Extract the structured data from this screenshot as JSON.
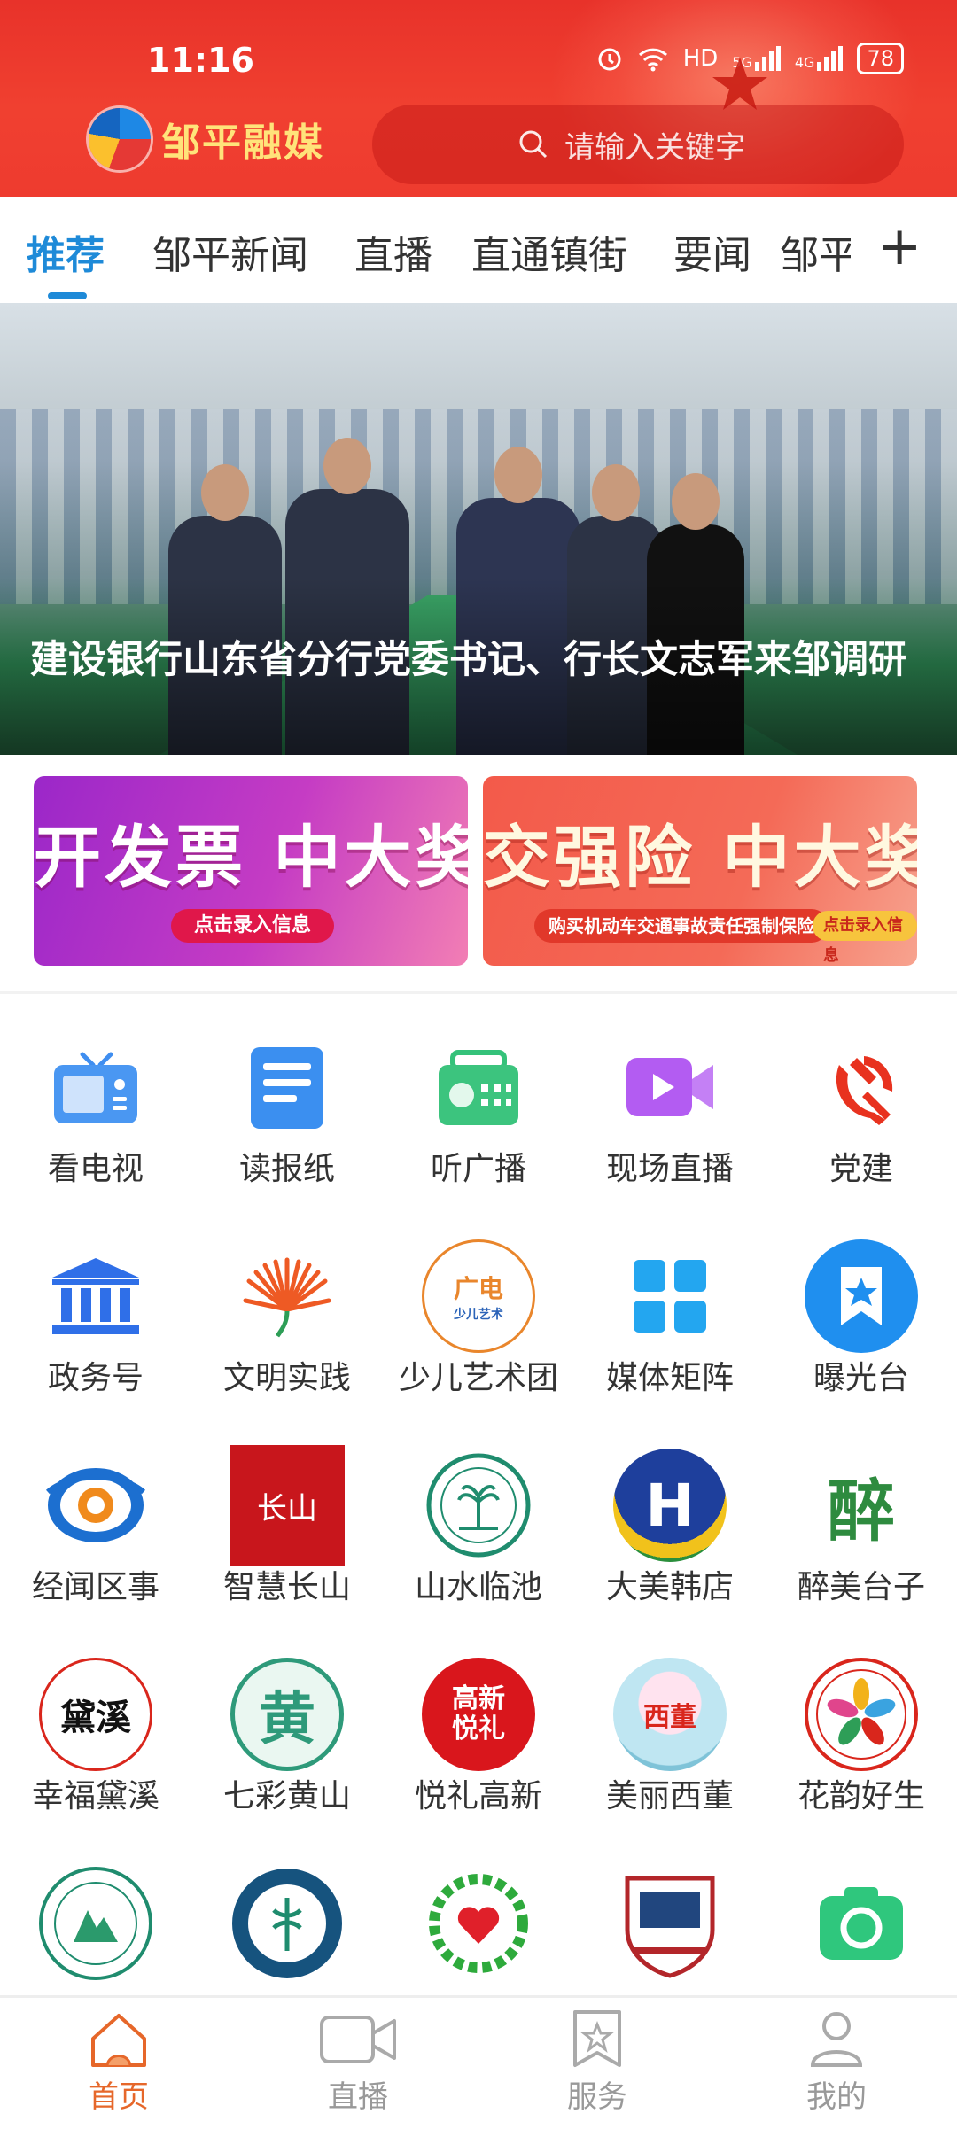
{
  "status_bar": {
    "time": "11:16",
    "network": "HD",
    "signal1": "5G",
    "signal2": "4G",
    "battery": "78"
  },
  "header": {
    "app_name": "邹平融媒",
    "search_placeholder": "请输入关键字"
  },
  "tabs": [
    {
      "label": "推荐",
      "active": true
    },
    {
      "label": "邹平新闻"
    },
    {
      "label": "直播"
    },
    {
      "label": "直通镇街"
    },
    {
      "label": "要闻"
    },
    {
      "label": "邹平"
    }
  ],
  "hero": {
    "caption": "建设银行山东省分行党委书记、行长文志军来邹调研"
  },
  "banners": [
    {
      "headline": "开发票 中大奖",
      "button": "点击录入信息"
    },
    {
      "headline": "交强险 中大奖",
      "subtext": "购买机动车交通事故责任强制保险",
      "button": "点击录入信息"
    }
  ],
  "services": [
    {
      "label": "看电视",
      "icon": "tv-icon"
    },
    {
      "label": "读报纸",
      "icon": "newspaper-icon"
    },
    {
      "label": "听广播",
      "icon": "radio-icon"
    },
    {
      "label": "现场直播",
      "icon": "video-camera-icon"
    },
    {
      "label": "党建",
      "icon": "party-emblem-icon"
    },
    {
      "label": "政务号",
      "icon": "government-building-icon"
    },
    {
      "label": "文明实践",
      "icon": "civilization-logo-icon"
    },
    {
      "label": "少儿艺术团",
      "icon": "children-art-logo-icon",
      "badge_text": "广电",
      "badge_sub": "少儿艺术"
    },
    {
      "label": "媒体矩阵",
      "icon": "grid-squares-icon"
    },
    {
      "label": "曝光台",
      "icon": "bookmark-star-icon"
    },
    {
      "label": "经闻区事",
      "icon": "district-news-logo-icon"
    },
    {
      "label": "智慧长山",
      "icon": "changshan-logo-icon",
      "badge_text": "长山"
    },
    {
      "label": "山水临池",
      "icon": "linchi-logo-icon"
    },
    {
      "label": "大美韩店",
      "icon": "handian-logo-icon",
      "badge_text": "H"
    },
    {
      "label": "醉美台子",
      "icon": "taizi-logo-icon",
      "badge_text": "醉"
    },
    {
      "label": "幸福黛溪",
      "icon": "daixi-logo-icon",
      "badge_text": "黛溪"
    },
    {
      "label": "七彩黄山",
      "icon": "huangshan-logo-icon",
      "badge_text": "黄"
    },
    {
      "label": "悦礼高新",
      "icon": "gaoxin-logo-icon",
      "badge_text": "高新悦礼"
    },
    {
      "label": "美丽西董",
      "icon": "xidong-logo-icon",
      "badge_text": "西董"
    },
    {
      "label": "花韵好生",
      "icon": "haosheng-logo-icon"
    },
    {
      "label": "",
      "icon": "hospital-logo-icon"
    },
    {
      "label": "",
      "icon": "tcm-hospital-logo-icon"
    },
    {
      "label": "",
      "icon": "heart-wreath-logo-icon"
    },
    {
      "label": "",
      "icon": "school-badge-icon"
    },
    {
      "label": "",
      "icon": "camera-icon"
    }
  ],
  "bottom_nav": [
    {
      "label": "首页",
      "icon": "home-icon",
      "active": true
    },
    {
      "label": "直播",
      "icon": "live-video-icon"
    },
    {
      "label": "服务",
      "icon": "service-star-icon"
    },
    {
      "label": "我的",
      "icon": "user-icon"
    }
  ],
  "colors": {
    "header_red": "#ee3b2f",
    "tab_active": "#1e8ad8",
    "nav_active": "#e6672a"
  }
}
